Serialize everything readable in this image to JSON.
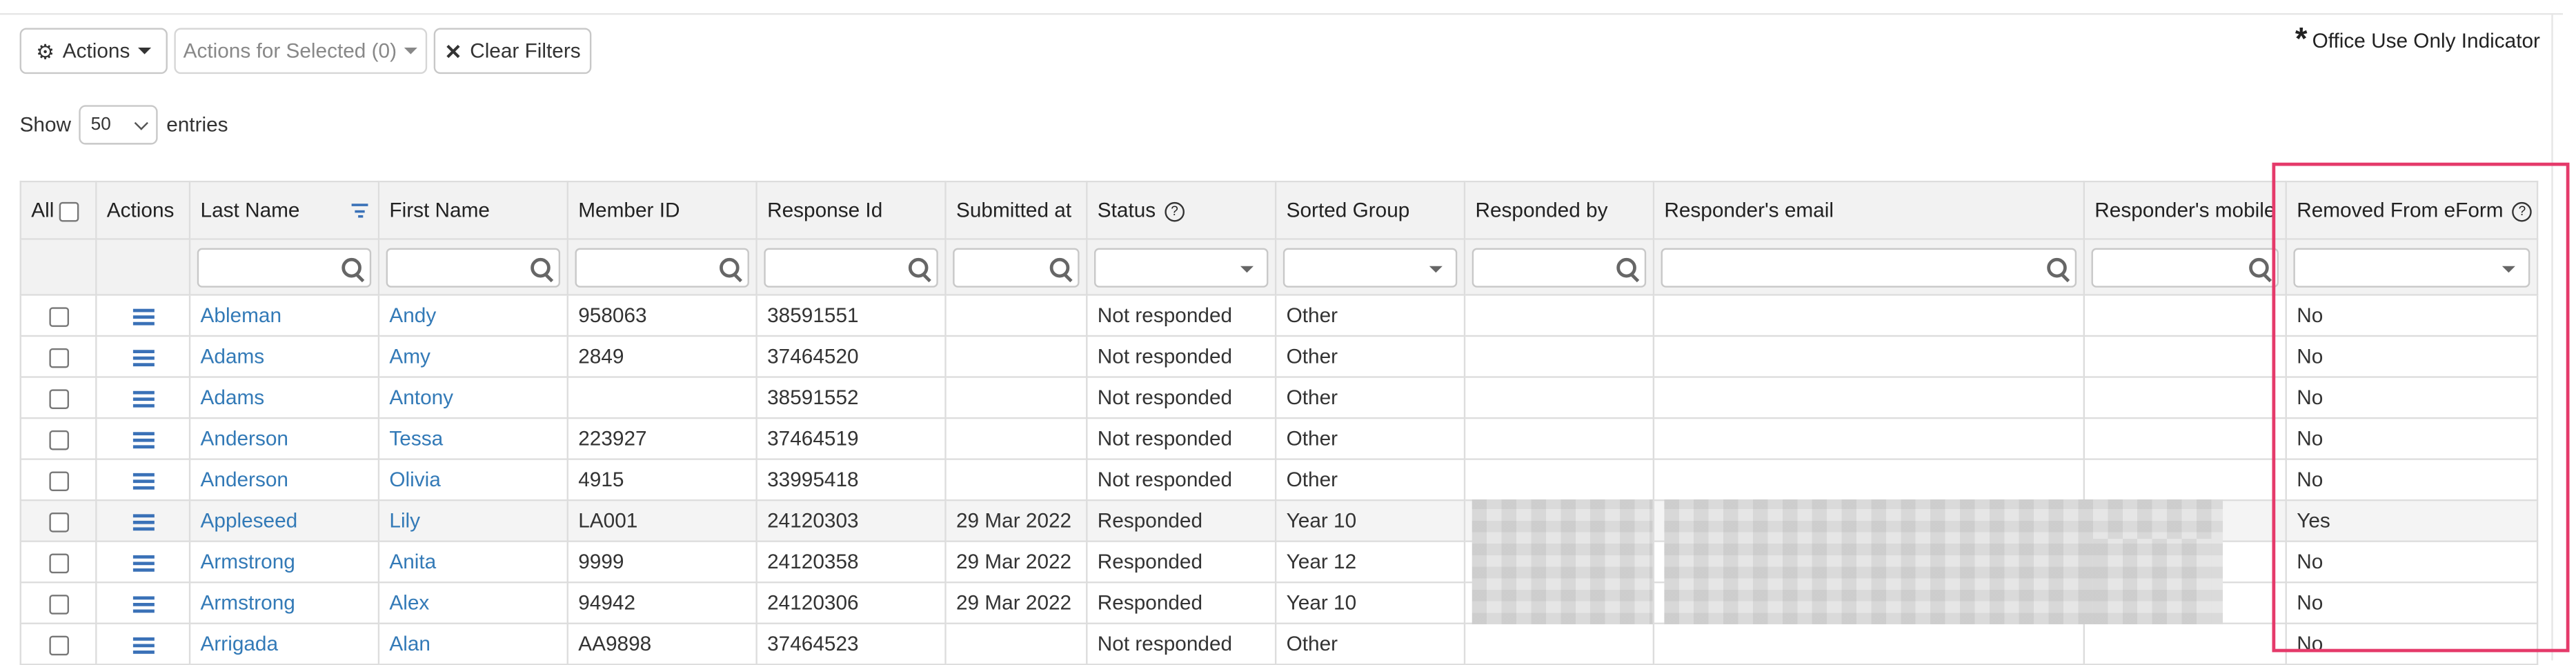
{
  "toolbar": {
    "actions_label": "Actions",
    "actions_selected_label": "Actions for Selected (0)",
    "clear_filters_label": "Clear Filters"
  },
  "office_indicator": {
    "symbol": "*",
    "label": "Office Use Only Indicator"
  },
  "entries": {
    "show_label": "Show",
    "value": "50",
    "entries_label": "entries"
  },
  "table": {
    "headers": {
      "all": "All",
      "actions": "Actions",
      "last_name": "Last Name",
      "first_name": "First Name",
      "member_id": "Member ID",
      "response_id": "Response Id",
      "submitted_at": "Submitted at",
      "status": "Status",
      "sorted_group": "Sorted Group",
      "responded_by": "Responded by",
      "responder_email": "Responder's email",
      "responder_mobile": "Responder's mobile",
      "removed": "Removed From eForm"
    },
    "rows": [
      {
        "last_name": "Ableman",
        "first_name": "Andy",
        "member_id": "958063",
        "response_id": "38591551",
        "submitted": "",
        "status": "Not responded",
        "group": "Other",
        "removed": "No"
      },
      {
        "last_name": "Adams",
        "first_name": "Amy",
        "member_id": "2849",
        "response_id": "37464520",
        "submitted": "",
        "status": "Not responded",
        "group": "Other",
        "removed": "No"
      },
      {
        "last_name": "Adams",
        "first_name": "Antony",
        "member_id": "",
        "response_id": "38591552",
        "submitted": "",
        "status": "Not responded",
        "group": "Other",
        "removed": "No"
      },
      {
        "last_name": "Anderson",
        "first_name": "Tessa",
        "member_id": "223927",
        "response_id": "37464519",
        "submitted": "",
        "status": "Not responded",
        "group": "Other",
        "removed": "No"
      },
      {
        "last_name": "Anderson",
        "first_name": "Olivia",
        "member_id": "4915",
        "response_id": "33995418",
        "submitted": "",
        "status": "Not responded",
        "group": "Other",
        "removed": "No"
      },
      {
        "last_name": "Appleseed",
        "first_name": "Lily",
        "member_id": "LA001",
        "response_id": "24120303",
        "submitted": "29 Mar 2022",
        "status": "Responded",
        "group": "Year 10",
        "removed": "Yes"
      },
      {
        "last_name": "Armstrong",
        "first_name": "Anita",
        "member_id": "9999",
        "response_id": "24120358",
        "submitted": "29 Mar 2022",
        "status": "Responded",
        "group": "Year 12",
        "removed": "No"
      },
      {
        "last_name": "Armstrong",
        "first_name": "Alex",
        "member_id": "94942",
        "response_id": "24120306",
        "submitted": "29 Mar 2022",
        "status": "Responded",
        "group": "Year 10",
        "removed": "No"
      },
      {
        "last_name": "Arrigada",
        "first_name": "Alan",
        "member_id": "AA9898",
        "response_id": "37464523",
        "submitted": "",
        "status": "Not responded",
        "group": "Other",
        "removed": "No"
      }
    ]
  }
}
